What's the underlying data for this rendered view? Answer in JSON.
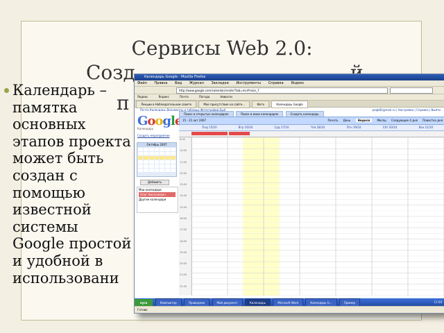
{
  "slide": {
    "title_line1": "Сервисы Web 2.0:",
    "title_line2": "Созд",
    "title_line2_end": "й",
    "title_line3": "п",
    "bullet": "Календарь – памятка основных этапов проекта может быть создан с помощью известной системы Google простой и удобной в использовани"
  },
  "window": {
    "title": "Календарь Google - Mozilla Firefox",
    "menu": [
      "Файл",
      "Правка",
      "Вид",
      "Журнал",
      "Закладки",
      "Инструменты",
      "Справка",
      "Яндекс"
    ],
    "address": "http://www.google.com/calendar/render?tab=mc#main_7",
    "toolbar2": [
      "Яндекс",
      "Яндекс",
      "Почта",
      "Погода",
      "Новости"
    ],
    "tabs": [
      "Лекции в Наблюдательном совете",
      "Мое присутствие на сайте...",
      "Фото",
      "Календарь Google"
    ],
    "gbar_left": "Почта  Календарь  Документы и таблицы  Фотографии  Ещё",
    "gbar_right": "peqb82@mail.ru | Настройки | Справка | Выйти"
  },
  "sidebar": {
    "sub": "Календарь",
    "create": "Создать мероприятие",
    "month": "Октябрь 2007",
    "add": "Добавить",
    "my_cal": "Мои календари",
    "cal1": "Олег Николаевич",
    "other": "Другие календари"
  },
  "calendar": {
    "navtabs": [
      "Поиск в открытых календарях",
      "Поиск в моих календарях",
      "Создать календарь"
    ],
    "range": "15 - 21 окт 2007",
    "views": [
      "Печать",
      "День",
      "Неделя",
      "Месяц",
      "Следующие 4 дня",
      "Повестка дня"
    ],
    "active_view": "Неделя",
    "days": [
      "Пнд 15/10",
      "Втр 16/10",
      "Срд 17/10",
      "Чтв 18/10",
      "Птн 19/10",
      "Сбт 20/10",
      "Вск 21/10"
    ],
    "times": [
      "9:00",
      "10:00",
      "11:00",
      "12:00",
      "13:00",
      "14:00",
      "15:00",
      "16:00",
      "17:00",
      "18:00",
      "19:00",
      "20:00",
      "21:00",
      "22:00"
    ]
  },
  "taskbar": {
    "start": "пуск",
    "tasks": [
      "Компьютер",
      "Проводник",
      "Мой документ",
      "Календарь",
      "Microsoft Word",
      "Календарь G...",
      "Пример",
      "RU"
    ],
    "clock": "11:50"
  },
  "status": "Готово"
}
